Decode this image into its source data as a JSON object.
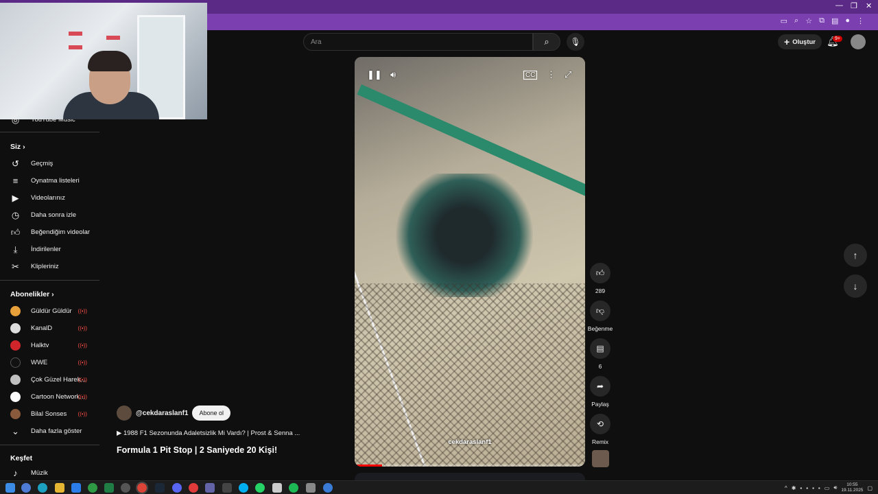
{
  "header": {
    "search_placeholder": "Ara",
    "create_label": "Oluştur",
    "notif_badge": "9+"
  },
  "sidebar": {
    "music_label": "YouTube Music",
    "you_heading": "Siz",
    "you_items": [
      {
        "label": "Geçmiş",
        "icon": "history-icon"
      },
      {
        "label": "Oynatma listeleri",
        "icon": "playlist-icon"
      },
      {
        "label": "Videolarınız",
        "icon": "your-videos-icon"
      },
      {
        "label": "Daha sonra izle",
        "icon": "watch-later-icon"
      },
      {
        "label": "Beğendiğim videolar",
        "icon": "liked-icon"
      },
      {
        "label": "İndirilenler",
        "icon": "download-icon"
      },
      {
        "label": "Klipleriniz",
        "icon": "clips-icon"
      }
    ],
    "subs_heading": "Abonelikler",
    "subs": [
      {
        "label": "Güldür Güldür",
        "color": "#e8a13a"
      },
      {
        "label": "KanalD",
        "color": "#dddddd"
      },
      {
        "label": "Halktv",
        "color": "#d0262b"
      },
      {
        "label": "WWE",
        "color": "#111111"
      },
      {
        "label": "Çok Güzel Harek...",
        "color": "#c0c0c0"
      },
      {
        "label": "Cartoon Network...",
        "color": "#ffffff"
      },
      {
        "label": "Bilal Sonses",
        "color": "#8a5a3c"
      }
    ],
    "show_more": "Daha fazla göster",
    "explore_heading": "Keşfet",
    "explore_items": [
      {
        "label": "Müzik",
        "icon": "music-icon"
      }
    ]
  },
  "video": {
    "watermark": "cekdaraslanf1",
    "progress": 0.12,
    "channel": "@cekdaraslanf1",
    "subscribe_label": "Abone ol",
    "related": "▶ 1988 F1 Sezonunda Adaletsizlik Mi Vardı? | Prost & Senna ...",
    "title": "Formula 1 Pit Stop | 2 Saniyede 20 Kişi!"
  },
  "actions": {
    "likes": "289",
    "dislike_label": "Beğenme",
    "comments": "6",
    "share_label": "Paylaş",
    "remix_label": "Remix"
  },
  "taskbar": {
    "time": "10:55",
    "date": "19.11.2025"
  },
  "colors": {
    "titlebar": "#5b2a86",
    "addressbar": "#7b3fb0",
    "background": "#0f0f0f",
    "accent_red": "#ff0000"
  }
}
